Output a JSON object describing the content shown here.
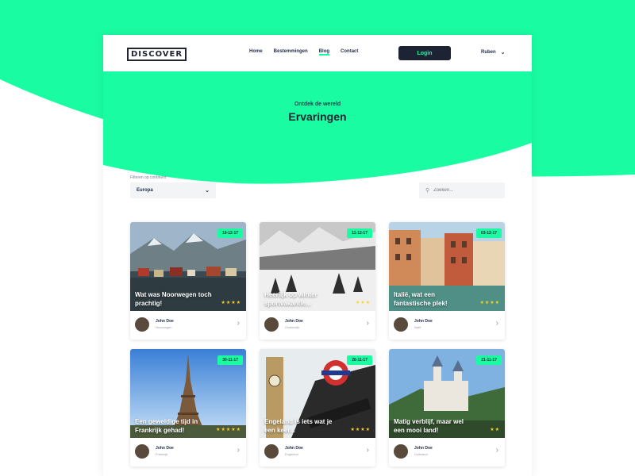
{
  "nav": {
    "logo": "DISCOVER",
    "links": [
      "Home",
      "Bestemmingen",
      "Blog",
      "Contact"
    ],
    "cta": "Login",
    "user": "Ruben"
  },
  "hero": {
    "subtitle": "Ontdek de wereld",
    "title": "Ervaringen"
  },
  "filters": {
    "continent_label": "Filteren op continent",
    "continent_value": "Europa",
    "search_placeholder": "Zoeken..."
  },
  "cards": [
    {
      "date": "19-12-17",
      "title": "Wat was Noorwegen toch prachtig!",
      "stars": "★★★★",
      "author": "John Doe",
      "place": "Noorwegen"
    },
    {
      "date": "11-12-17",
      "title": "Heerlijk op winter sportvakantie...",
      "stars": "★★★",
      "author": "John Doe",
      "place": "Oostenrijk"
    },
    {
      "date": "03-12-17",
      "title": "Italië, wat een fantastische plek!",
      "stars": "★★★★",
      "author": "John Doe",
      "place": "Italië"
    },
    {
      "date": "30-11-17",
      "title": "Een geweldige tijd in Frankrijk gehad!",
      "stars": "★★★★★",
      "author": "John Doe",
      "place": "Frankrijk"
    },
    {
      "date": "26-11-17",
      "title": "Engeland is iets wat je een keer...",
      "stars": "★★★★",
      "author": "John Doe",
      "place": "Engeland"
    },
    {
      "date": "21-11-17",
      "title": "Matig verblijf, maar wel een mooi land!",
      "stars": "★★",
      "author": "John Doe",
      "place": "Duitsland"
    }
  ],
  "colors": {
    "accent": "#1afca2",
    "dark": "#1d2333",
    "star": "#ffd21f"
  }
}
